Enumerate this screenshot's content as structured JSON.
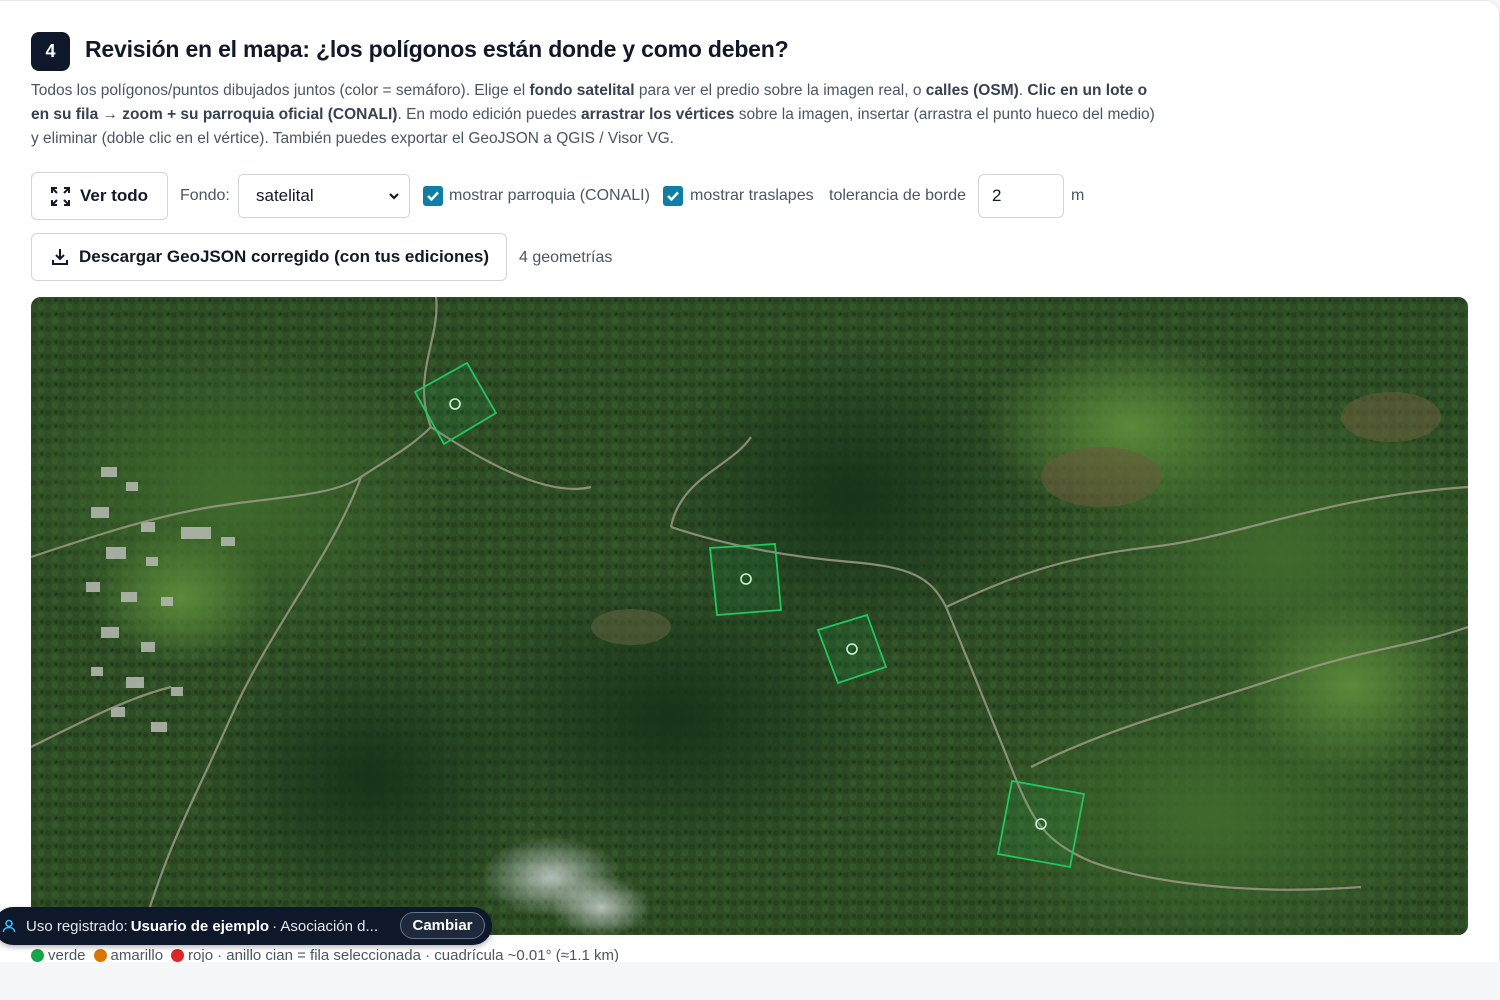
{
  "section": {
    "step": "4",
    "title": "Revisión en el mapa: ¿los polígonos están donde y como deben?"
  },
  "description": {
    "p1": "Todos los polígonos/puntos dibujados juntos (color = semáforo). Elige el ",
    "b1": "fondo satelital",
    "p2": " para ver el predio sobre la imagen real, o ",
    "b2": "calles (OSM)",
    "p3": ". ",
    "b3": "Clic en un lote o en su fila → zoom + su parroquia oficial (CONALI)",
    "p4": ". En modo edición puedes ",
    "b4": "arrastrar los vértices",
    "p5": " sobre la imagen, insertar (arrastra el punto hueco del medio) y eliminar (doble clic en el vértice). También puedes exportar el GeoJSON a QGIS / Visor VG."
  },
  "toolbar": {
    "ver_todo_label": "Ver todo",
    "fondo_label": "Fondo:",
    "fondo_value": "satelital",
    "parroquia_label": "mostrar parroquia (CONALI)",
    "parroquia_checked": true,
    "traslapes_label": "mostrar traslapes",
    "traslapes_checked": true,
    "tolerancia_label": "tolerancia de borde",
    "tolerancia_value": "2",
    "tolerancia_unit": "m",
    "download_label": "Descargar GeoJSON corregido (con tus ediciones)",
    "geometry_count": "4 geometrías"
  },
  "map": {
    "basemap": "satellite",
    "polygon_status": [
      "verde",
      "verde",
      "verde",
      "verde"
    ],
    "polygon_color": "#22c55e"
  },
  "legend": {
    "green": "verde",
    "green_color": "#16a34a",
    "yellow": "amarillo",
    "yellow_color": "#d97706",
    "red": "rojo",
    "red_color": "#dc2626",
    "rest": " · anillo cian = fila seleccionada · cuadrícula ~0.01° (≈1.1 km)"
  },
  "session": {
    "prefix": "Uso registrado:",
    "user": "Usuario de ejemplo",
    "org": "· Asociación d...",
    "change_label": "Cambiar"
  }
}
